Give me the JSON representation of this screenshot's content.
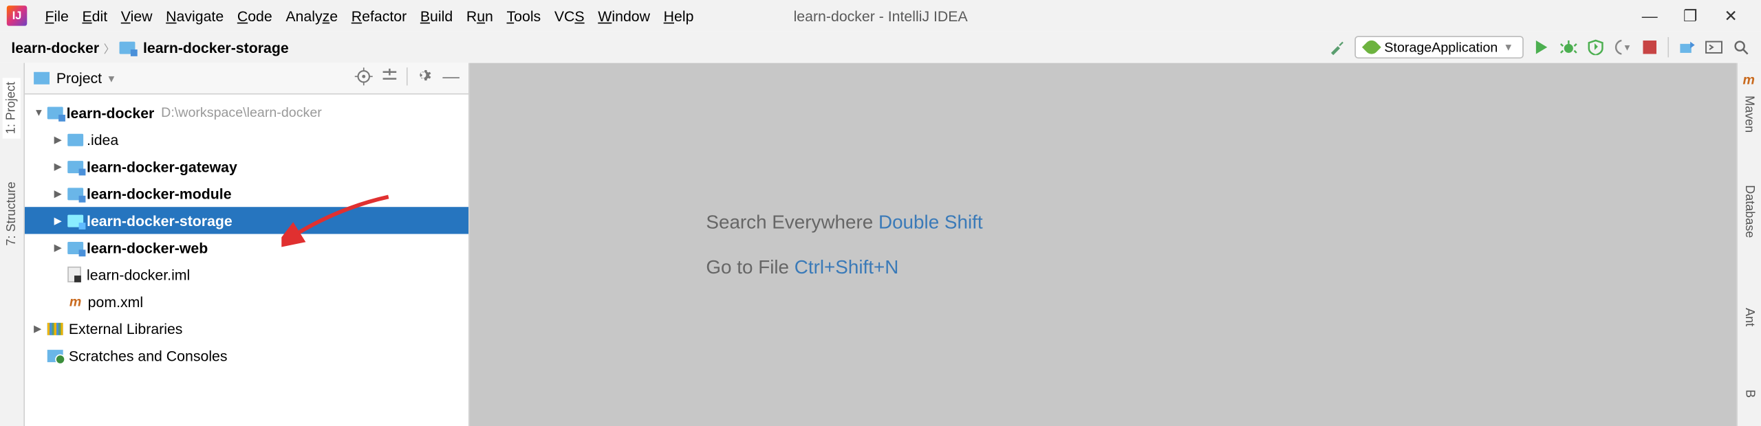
{
  "app_icon_letter": "IJ",
  "menu": {
    "file": "File",
    "edit": "Edit",
    "view": "View",
    "navigate": "Navigate",
    "code": "Code",
    "analyze": "Analyze",
    "refactor": "Refactor",
    "build": "Build",
    "run": "Run",
    "tools": "Tools",
    "vcs": "VCS",
    "window": "Window",
    "help": "Help"
  },
  "window_title": "learn-docker - IntelliJ IDEA",
  "breadcrumb": {
    "root": "learn-docker",
    "current": "learn-docker-storage"
  },
  "run_config": {
    "selected": "StorageApplication"
  },
  "left_tabs": {
    "project": "1: Project",
    "structure": "7: Structure"
  },
  "right_tabs": {
    "maven": "Maven",
    "database": "Database",
    "ant": "Ant",
    "b": "B"
  },
  "panel": {
    "title": "Project",
    "tree": {
      "root": {
        "name": "learn-docker",
        "path": "D:\\workspace\\learn-docker"
      },
      "children": [
        {
          "name": ".idea",
          "type": "folder",
          "bold": false
        },
        {
          "name": "learn-docker-gateway",
          "type": "module",
          "bold": true
        },
        {
          "name": "learn-docker-module",
          "type": "module",
          "bold": true
        },
        {
          "name": "learn-docker-storage",
          "type": "module",
          "bold": true,
          "selected": true
        },
        {
          "name": "learn-docker-web",
          "type": "module",
          "bold": true
        },
        {
          "name": "learn-docker.iml",
          "type": "file-iml",
          "bold": false
        },
        {
          "name": "pom.xml",
          "type": "file-maven",
          "bold": false
        }
      ],
      "external_libs": "External Libraries",
      "scratches": "Scratches and Consoles"
    }
  },
  "editor_hints": {
    "search_label": "Search Everywhere ",
    "search_key": "Double Shift",
    "goto_label": "Go to File ",
    "goto_key": "Ctrl+Shift+N"
  }
}
